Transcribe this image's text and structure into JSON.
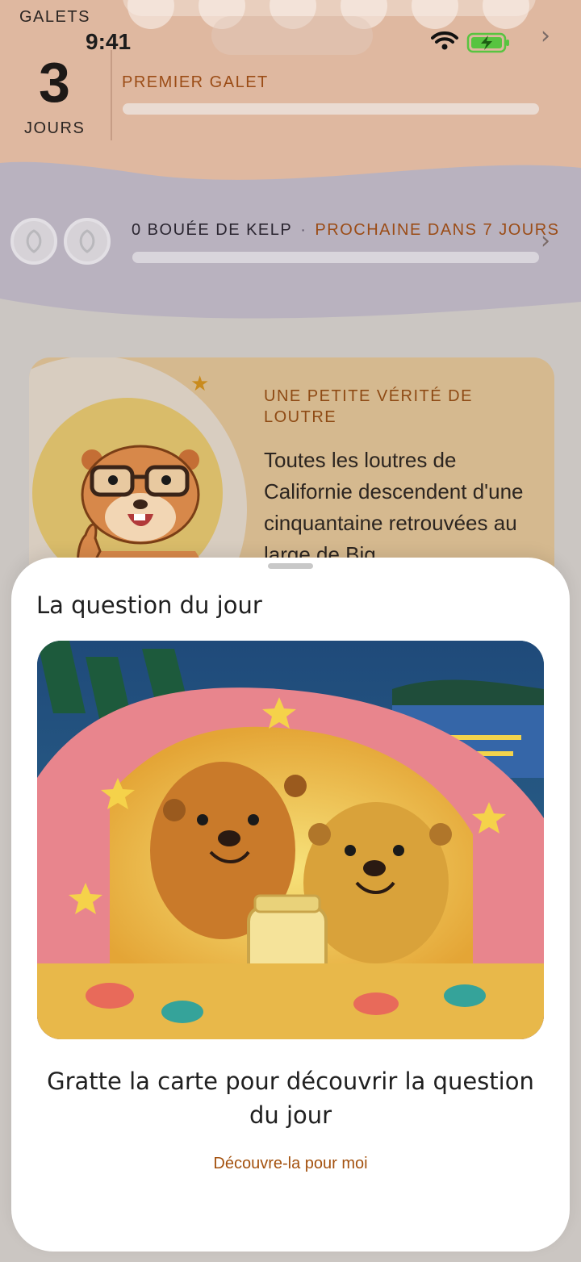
{
  "status_bar": {
    "time": "9:41"
  },
  "streak": {
    "title": "GALETS",
    "count": "3",
    "unit": "JOURS",
    "goal_label": "PREMIER GALET",
    "goal_progress": 0
  },
  "kelp": {
    "count_label": "0 BOUÉE DE KELP",
    "separator": "·",
    "next_label": "PROCHAINE DANS 7 JOURS",
    "progress": 0
  },
  "fact": {
    "title": "UNE PETITE VÉRITÉ DE LOUTRE",
    "body": "Toutes les loutres de Californie descendent d'une cinquantaine retrouvées au large de Big"
  },
  "sheet": {
    "title": "La question du jour",
    "prompt": "Gratte la carte pour découvrir la question du jour",
    "reveal_label": "Découvre-la pour moi"
  },
  "icons": {
    "chevron": "chevron-right-icon",
    "wifi": "wifi-icon",
    "battery": "battery-charging-icon",
    "kelp_buoy": "kelp-buoy-icon",
    "star": "star-icon"
  },
  "colors": {
    "accent": "#9b4c16",
    "peach_band": "#dfb8a0",
    "lavender_band": "#b9b2bf",
    "card": "#d5b98f",
    "battery": "#58c440"
  }
}
